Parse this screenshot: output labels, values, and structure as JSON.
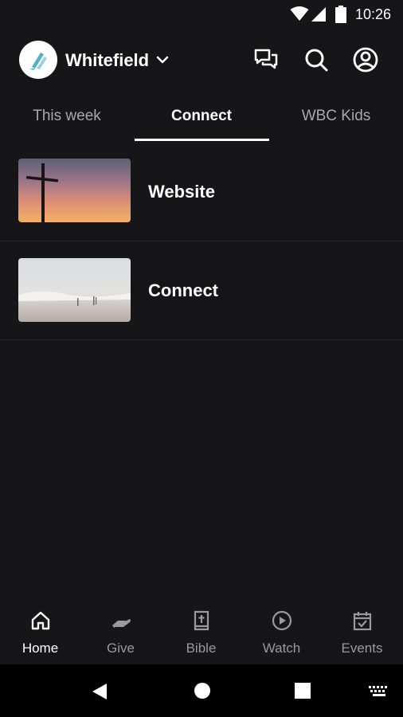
{
  "status_bar": {
    "time": "10:26"
  },
  "header": {
    "church_name": "Whitefield"
  },
  "tabs": [
    {
      "label": "This week",
      "active": false
    },
    {
      "label": "Connect",
      "active": true
    },
    {
      "label": "WBC Kids",
      "active": false
    }
  ],
  "items": [
    {
      "title": "Website"
    },
    {
      "title": "Connect"
    }
  ],
  "bottom_nav": [
    {
      "label": "Home",
      "icon": "home-icon",
      "active": true
    },
    {
      "label": "Give",
      "icon": "give-icon",
      "active": false
    },
    {
      "label": "Bible",
      "icon": "bible-icon",
      "active": false
    },
    {
      "label": "Watch",
      "icon": "play-circle-icon",
      "active": false
    },
    {
      "label": "Events",
      "icon": "calendar-check-icon",
      "active": false
    }
  ],
  "colors": {
    "background": "#161618",
    "text_active": "#ffffff",
    "text_inactive": "#a9a9ab",
    "logo_accent": "#4fb2c3"
  }
}
